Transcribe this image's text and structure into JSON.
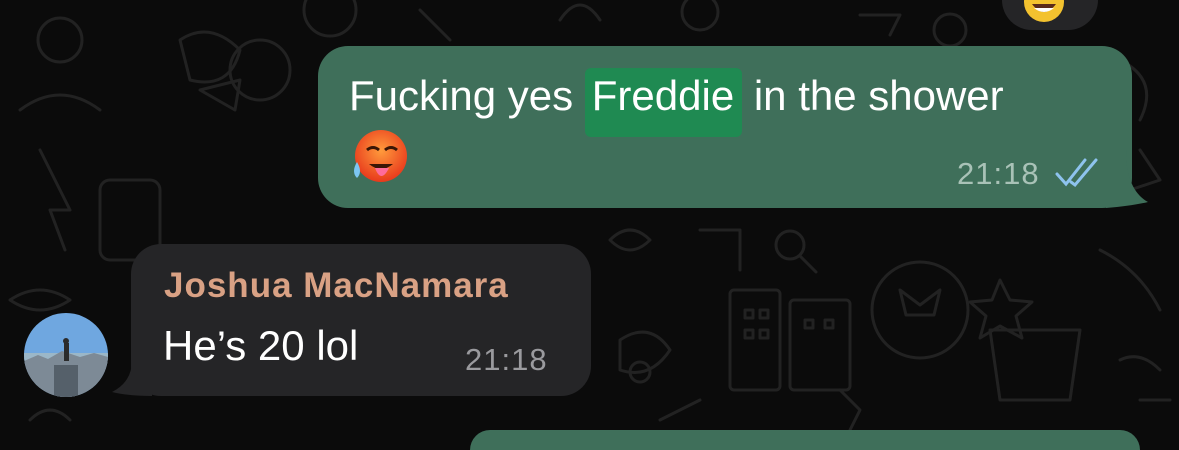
{
  "chat": {
    "messages": [
      {
        "direction": "outgoing",
        "text_before": "Fucking yes ",
        "highlight": "Freddie",
        "text_after": " in the shower",
        "emoji": "hot-face-tongue-emoji",
        "time": "21:18",
        "status": "read"
      },
      {
        "direction": "incoming",
        "sender": "Joshua MacNamara",
        "text": "He’s 20 lol",
        "time": "21:18",
        "avatar": "avatar-photo"
      }
    ]
  },
  "colors": {
    "background": "#0b0b0b",
    "outgoing_bubble": "#3f6f5a",
    "incoming_bubble": "#252527",
    "highlight": "#1f8a52",
    "sender_name": "#d9a184",
    "read_ticks": "#8ec3ee"
  }
}
